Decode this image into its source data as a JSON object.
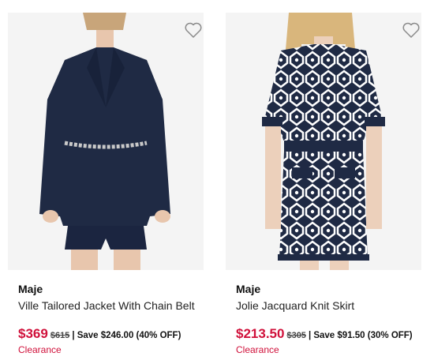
{
  "products": [
    {
      "brand": "Maje",
      "title": "Ville Tailored Jacket With Chain Belt",
      "sale_price": "$369",
      "original_price": "$615",
      "savings": "| Save $246.00 (40% OFF)",
      "badge": "Clearance",
      "wishlist_icon": "heart-outline-icon",
      "image_alt": "Model wearing navy tailored blazer with chain belt and matching shorts"
    },
    {
      "brand": "Maje",
      "title": "Jolie Jacquard Knit Skirt",
      "sale_price": "$213.50",
      "original_price": "$305",
      "savings": "| Save $91.50 (30% OFF)",
      "badge": "Clearance",
      "wishlist_icon": "heart-outline-icon",
      "image_alt": "Model wearing navy and white geometric jacquard knit top and skirt"
    }
  ],
  "colors": {
    "sale": "#d0103a",
    "navy": "#1f2a44",
    "text": "#111111"
  }
}
